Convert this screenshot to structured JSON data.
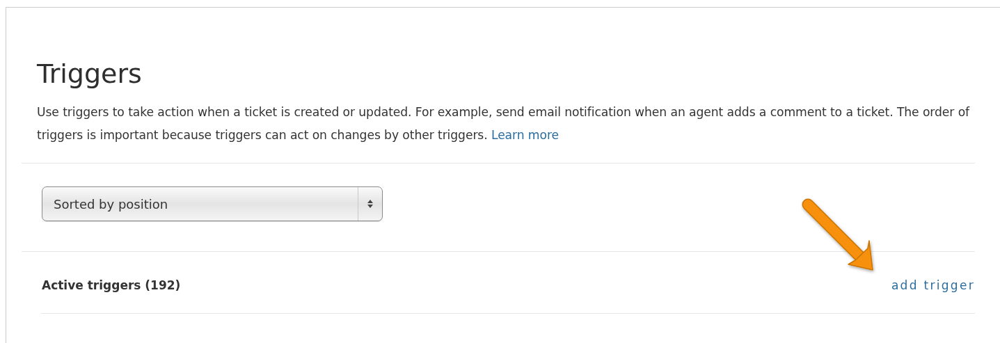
{
  "title": "Triggers",
  "description": "Use triggers to take action when a ticket is created or updated. For example, send email notification when an agent adds a comment to a ticket. The order of triggers is important because triggers can act on changes by other triggers.",
  "learn_more_link": "Learn more",
  "sort_select": {
    "value": "Sorted by position"
  },
  "section": {
    "title": "Active triggers (192)",
    "add_link": "add trigger"
  }
}
